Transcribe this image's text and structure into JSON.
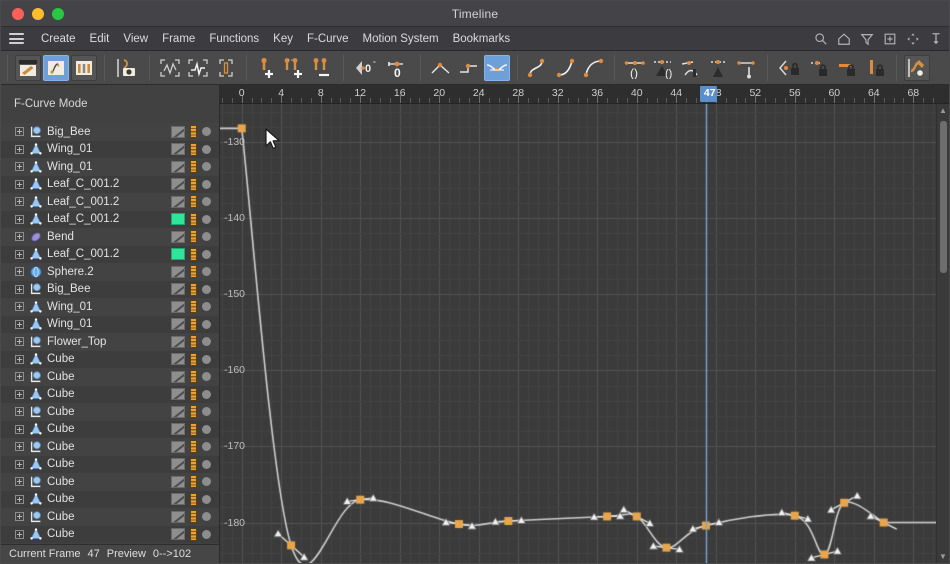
{
  "window": {
    "title": "Timeline",
    "traffic_lights": [
      "close-red",
      "minimize-yellow",
      "maximize-green"
    ]
  },
  "menu": {
    "hamburger": "menu-icon",
    "items": [
      {
        "label": "Create"
      },
      {
        "label": "Edit"
      },
      {
        "label": "View"
      },
      {
        "label": "Frame"
      },
      {
        "label": "Functions"
      },
      {
        "label": "Key"
      },
      {
        "label": "F-Curve"
      },
      {
        "label": "Motion System"
      },
      {
        "label": "Bookmarks"
      }
    ],
    "right_icons": [
      "search-icon",
      "home-icon",
      "filter-icon",
      "add-box-icon",
      "move-icon",
      "pin-icon"
    ]
  },
  "toolbar": {
    "groups": [
      {
        "name": "mode-group",
        "buttons": [
          {
            "name": "keyframe-mode-button",
            "icon": "key-mode-icon",
            "state": "flat"
          },
          {
            "name": "fcurve-mode-button",
            "icon": "fcurve-mode-icon",
            "state": "active"
          },
          {
            "name": "motion-mode-button",
            "icon": "motion-mode-icon",
            "state": "flat"
          }
        ]
      },
      {
        "name": "record-group",
        "buttons": [
          {
            "name": "autokey-record-button",
            "icon": "record-key-icon",
            "state": "normal"
          }
        ]
      },
      {
        "name": "framing-group",
        "buttons": [
          {
            "name": "frame-all-button",
            "icon": "frame-all-icon",
            "state": "normal"
          },
          {
            "name": "frame-selected-button",
            "icon": "frame-selected-icon",
            "state": "normal"
          },
          {
            "name": "frame-value-range-button",
            "icon": "frame-value-icon",
            "state": "normal"
          }
        ]
      },
      {
        "name": "key-edit-group",
        "buttons": [
          {
            "name": "add-key-button",
            "icon": "key-plus-icon",
            "state": "normal"
          },
          {
            "name": "duplicate-key-button",
            "icon": "keys-plus-icon",
            "state": "normal"
          },
          {
            "name": "delete-key-button",
            "icon": "keys-minus-icon",
            "state": "normal"
          }
        ]
      },
      {
        "name": "angle-group",
        "buttons": [
          {
            "name": "rotation-zero-button",
            "icon": "angle-zero-icon",
            "state": "normal"
          },
          {
            "name": "value-zero-button",
            "icon": "value-zero-icon",
            "state": "normal"
          }
        ]
      },
      {
        "name": "interpolation-group",
        "buttons": [
          {
            "name": "linear-interpolation-button",
            "icon": "linear-tangent-icon",
            "state": "normal"
          },
          {
            "name": "step-interpolation-button",
            "icon": "step-tangent-icon",
            "state": "normal"
          },
          {
            "name": "spline-interpolation-button",
            "icon": "spline-tangent-icon",
            "state": "active"
          }
        ]
      },
      {
        "name": "ease-group",
        "buttons": [
          {
            "name": "ease-in-out-button",
            "icon": "ease-s-icon",
            "state": "normal"
          },
          {
            "name": "ease-in-button",
            "icon": "ease-in-icon",
            "state": "normal"
          },
          {
            "name": "ease-out-button",
            "icon": "ease-out-icon",
            "state": "normal"
          }
        ]
      },
      {
        "name": "tangent-group",
        "buttons": [
          {
            "name": "soft-tangent-button",
            "icon": "soft-tangent-icon",
            "state": "normal"
          },
          {
            "name": "clamp-tangent-button",
            "icon": "clamp-tangent-icon",
            "state": "normal"
          },
          {
            "name": "weight-tangent-button",
            "icon": "weight-tangent-icon",
            "state": "normal"
          },
          {
            "name": "break-tangent-button",
            "icon": "break-tangent-icon",
            "state": "normal"
          },
          {
            "name": "align-tangent-button",
            "icon": "align-tangent-icon",
            "state": "normal"
          }
        ]
      },
      {
        "name": "lock-group",
        "buttons": [
          {
            "name": "lock-tangent-button",
            "icon": "lock-tangent-icon",
            "state": "normal"
          },
          {
            "name": "lock-keyframe-button",
            "icon": "lock-key-icon",
            "state": "normal"
          },
          {
            "name": "lock-value-button",
            "icon": "lock-value-icon",
            "state": "normal"
          },
          {
            "name": "lock-time-button",
            "icon": "lock-time-icon",
            "state": "normal"
          }
        ]
      },
      {
        "name": "snapshot-group",
        "buttons": [
          {
            "name": "fcurve-snapshot-button",
            "icon": "snapshot-icon",
            "state": "flat"
          }
        ]
      }
    ]
  },
  "sidebar": {
    "mode_label": "F-Curve Mode",
    "objects": [
      {
        "label": "Big_Bee",
        "icon": "null-object-icon",
        "swatch": "gray"
      },
      {
        "label": "Wing_01",
        "icon": "cone-object-icon",
        "swatch": "gray"
      },
      {
        "label": "Wing_01",
        "icon": "cone-object-icon",
        "swatch": "gray"
      },
      {
        "label": "Leaf_C_001.2",
        "icon": "cone-object-icon",
        "swatch": "gray"
      },
      {
        "label": "Leaf_C_001.2",
        "icon": "cone-object-icon",
        "swatch": "gray"
      },
      {
        "label": "Leaf_C_001.2",
        "icon": "cone-object-icon",
        "swatch": "green"
      },
      {
        "label": "Bend",
        "icon": "deformer-icon",
        "swatch": "gray"
      },
      {
        "label": "Leaf_C_001.2",
        "icon": "cone-object-icon",
        "swatch": "green"
      },
      {
        "label": "Sphere.2",
        "icon": "sphere-object-icon",
        "swatch": "gray"
      },
      {
        "label": "Big_Bee",
        "icon": "null-object-icon",
        "swatch": "gray"
      },
      {
        "label": "Wing_01",
        "icon": "cone-object-icon",
        "swatch": "gray"
      },
      {
        "label": "Wing_01",
        "icon": "cone-object-icon",
        "swatch": "gray"
      },
      {
        "label": "Flower_Top",
        "icon": "null-object-icon",
        "swatch": "gray"
      },
      {
        "label": "Cube",
        "icon": "cone-object-icon",
        "swatch": "gray"
      },
      {
        "label": "Cube",
        "icon": "null-object-icon",
        "swatch": "gray"
      },
      {
        "label": "Cube",
        "icon": "cone-object-icon",
        "swatch": "gray"
      },
      {
        "label": "Cube",
        "icon": "null-object-icon",
        "swatch": "gray"
      },
      {
        "label": "Cube",
        "icon": "cone-object-icon",
        "swatch": "gray"
      },
      {
        "label": "Cube",
        "icon": "null-object-icon",
        "swatch": "gray"
      },
      {
        "label": "Cube",
        "icon": "cone-object-icon",
        "swatch": "gray"
      },
      {
        "label": "Cube",
        "icon": "null-object-icon",
        "swatch": "gray"
      },
      {
        "label": "Cube",
        "icon": "cone-object-icon",
        "swatch": "gray"
      },
      {
        "label": "Cube",
        "icon": "null-object-icon",
        "swatch": "gray"
      },
      {
        "label": "Cube",
        "icon": "cone-object-icon",
        "swatch": "gray"
      }
    ]
  },
  "status": {
    "current_frame_label": "Current Frame",
    "current_frame_value": "47",
    "preview_label": "Preview",
    "preview_range": "0-->102"
  },
  "colors": {
    "keyframe": "#e8a council",
    "keyframe_orange": "#e8a54a",
    "curve": "#d0d0d0",
    "tangent_handle": "#f0f0f0",
    "playhead": "#5b8fc9",
    "grid": "#4a4a4a",
    "graph_bg": "#3b3b3b",
    "accent_blue": "#6f9fd8",
    "swatch_green": "#2fe59a"
  },
  "chart_data": {
    "type": "line",
    "title": "",
    "xlabel": "",
    "ylabel": "",
    "xlim": [
      -2.2,
      70.5
    ],
    "ylim": [
      -186.5,
      -125.0
    ],
    "grid": true,
    "legend": false,
    "x_ticks": [
      0,
      4,
      8,
      12,
      16,
      20,
      24,
      28,
      32,
      36,
      40,
      44,
      48,
      52,
      56,
      60,
      64,
      68
    ],
    "y_ticks": [
      -130,
      -140,
      -150,
      -160,
      -170,
      -180
    ],
    "playhead_frame": 47,
    "playhead_label": "47",
    "cursor": {
      "x": 265,
      "y": 127
    },
    "series": [
      {
        "name": "fcurve",
        "color": "#d0d0d0",
        "keyframes": [
          {
            "frame": 0,
            "value": -128.2
          },
          {
            "frame": 5,
            "value": -183.0
          },
          {
            "frame": 12,
            "value": -177.0
          },
          {
            "frame": 22,
            "value": -180.2
          },
          {
            "frame": 27,
            "value": -179.8
          },
          {
            "frame": 37,
            "value": -179.2
          },
          {
            "frame": 40,
            "value": -179.2
          },
          {
            "frame": 43,
            "value": -183.3
          },
          {
            "frame": 47,
            "value": -180.4
          },
          {
            "frame": 56,
            "value": -179.1
          },
          {
            "frame": 59,
            "value": -184.2
          },
          {
            "frame": 61,
            "value": -177.4
          },
          {
            "frame": 65,
            "value": -180.0
          }
        ]
      }
    ]
  },
  "scrollbar": {
    "up_arrow": "chevron-up-icon",
    "down_arrow": "chevron-down-icon"
  }
}
